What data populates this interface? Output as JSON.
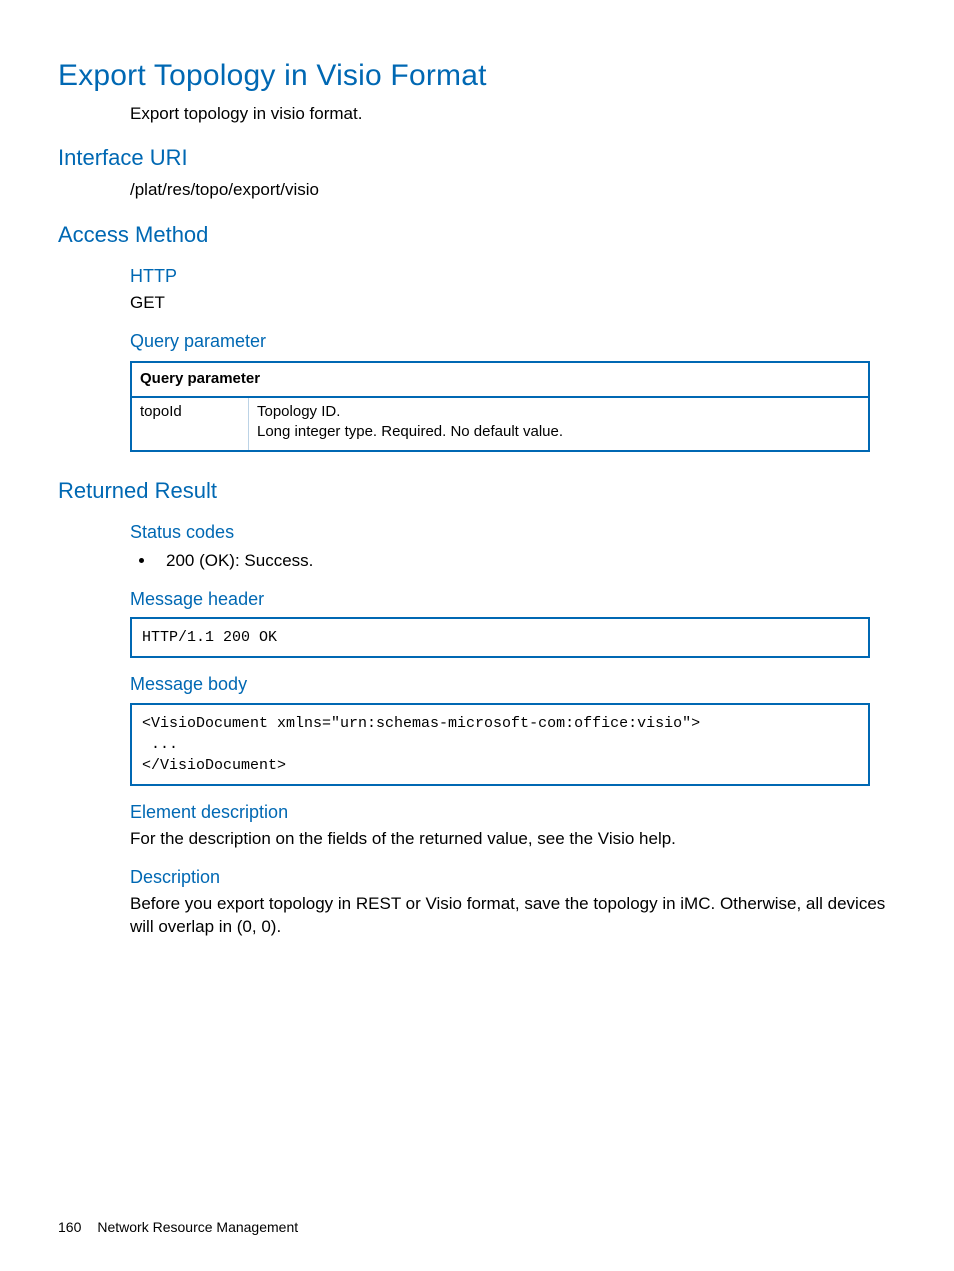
{
  "title": "Export Topology in Visio Format",
  "intro": "Export topology in visio format.",
  "interface_uri": {
    "heading": "Interface URI",
    "value": "/plat/res/topo/export/visio"
  },
  "access_method": {
    "heading": "Access Method",
    "http_heading": "HTTP",
    "http_value": "GET",
    "query_param_heading": "Query parameter",
    "table_header": "Query parameter",
    "param_name": "topoId",
    "param_desc_line1": "Topology ID.",
    "param_desc_line2": "Long integer type. Required. No default value."
  },
  "returned_result": {
    "heading": "Returned Result",
    "status_codes_heading": "Status codes",
    "status_code_item": "200 (OK): Success.",
    "message_header_heading": "Message header",
    "message_header_code": "HTTP/1.1 200 OK",
    "message_body_heading": "Message body",
    "message_body_code": "<VisioDocument xmlns=\"urn:schemas-microsoft-com:office:visio\">\n ...\n</VisioDocument>",
    "element_desc_heading": "Element description",
    "element_desc_text": "For the description on the fields of the returned value, see the Visio help.",
    "description_heading": "Description",
    "description_text": "Before you export topology in REST or Visio format, save the topology in iMC. Otherwise, all devices will overlap in (0, 0)."
  },
  "footer": {
    "page_number": "160",
    "section": "Network Resource Management"
  }
}
